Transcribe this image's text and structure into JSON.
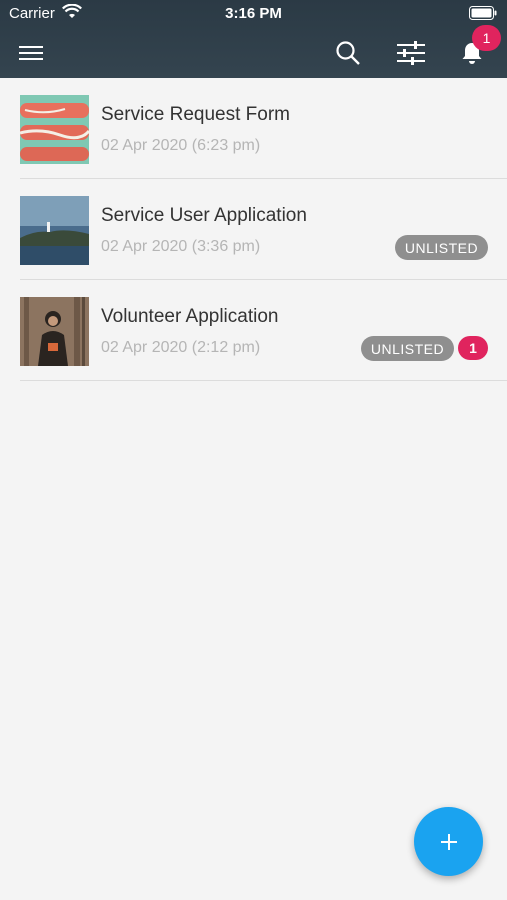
{
  "status_bar": {
    "carrier": "Carrier",
    "time": "3:16 PM"
  },
  "header": {
    "icons": [
      "menu-icon",
      "search-icon",
      "filter-icon",
      "bell-icon"
    ],
    "notification_count": "1"
  },
  "items": [
    {
      "title": "Service Request Form",
      "date": "02 Apr 2020 (6:23 pm)",
      "status": "",
      "count": ""
    },
    {
      "title": "Service User Application",
      "date": "02 Apr 2020 (3:36 pm)",
      "status": "UNLISTED",
      "count": ""
    },
    {
      "title": "Volunteer Application",
      "date": "02 Apr 2020 (2:12 pm)",
      "status": "UNLISTED",
      "count": "1"
    }
  ],
  "fab": {
    "label": "+"
  },
  "colors": {
    "header_bg": "#2b3a45",
    "badge": "#e0245e",
    "pill": "#8f8f8f",
    "fab": "#1aa3f0"
  }
}
